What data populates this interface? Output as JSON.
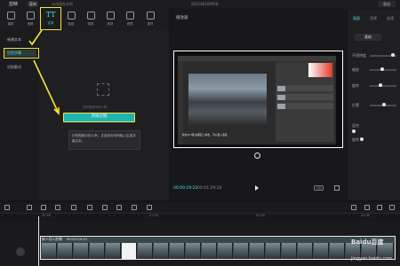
{
  "titlebar": {
    "app_name": "剪映",
    "menu": "菜单",
    "autosave": "自动保存本地",
    "project_name": "202106100916",
    "export": "导出"
  },
  "toolbar": {
    "tools": [
      {
        "label": "媒体",
        "icon": "media-icon"
      },
      {
        "label": "音频",
        "icon": "audio-icon"
      },
      {
        "label": "文本",
        "icon": "text-icon",
        "active": true
      },
      {
        "label": "贴纸",
        "icon": "sticker-icon"
      },
      {
        "label": "特效",
        "icon": "effects-icon"
      },
      {
        "label": "转场",
        "icon": "transition-icon"
      },
      {
        "label": "滤镜",
        "icon": "filter-icon"
      },
      {
        "label": "调节",
        "icon": "adjust-icon"
      }
    ]
  },
  "text_panel": {
    "nav": [
      {
        "label": "新建文本"
      },
      {
        "label": "识别字幕",
        "selected": true
      },
      {
        "label": "识别歌词"
      }
    ],
    "hint": "识别视频中的人声",
    "start_button": "开始识别",
    "description": "识别视频中的人声，并自动在时间轴上生成字幕文本。"
  },
  "player": {
    "title": "播放器",
    "caption_text": "按住Ctrl键 在图层上单击，可以载入选区",
    "time_current": "00:00:29:22",
    "time_total": "00:01:29:20",
    "ratio_label": "比例"
  },
  "right_panel": {
    "tabs": [
      "画面",
      "音频",
      "变速"
    ],
    "pill": "基础",
    "properties": [
      "不透明度",
      "缩放",
      "旋转",
      "位置",
      "混合",
      "旋转"
    ]
  },
  "timeline": {
    "ticks": [
      "00:00",
      "01:00",
      "02:00",
      "03:00"
    ],
    "clip_label": "新人导入剪辑",
    "clip_duration": "00:03:29:22"
  },
  "watermark": {
    "brand": "Baidu百度",
    "url": "jingyan.baidu.com"
  },
  "colors": {
    "accent": "#3ee6e6",
    "highlight": "#f6e43a",
    "button": "#1fb3b3"
  }
}
